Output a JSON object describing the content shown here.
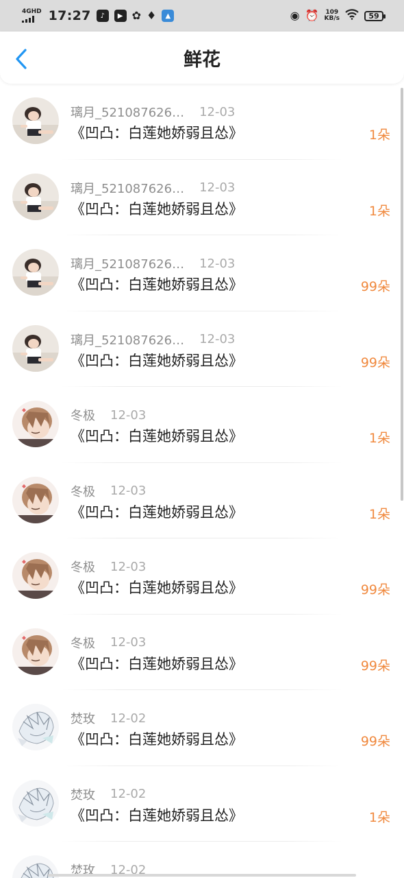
{
  "status_bar": {
    "network": "4GHD",
    "time": "17:27",
    "notification_icons": [
      "tiktok-icon",
      "video-icon",
      "wechat-icon",
      "pin-icon",
      "map-app-icon"
    ],
    "status_icons": [
      "location-icon",
      "alarm-icon"
    ],
    "speed_value": "109",
    "speed_unit": "KB/s",
    "battery": "59"
  },
  "header": {
    "title": "鲜花",
    "back_icon": "chevron-left-icon"
  },
  "colors": {
    "accent": "#2196f3",
    "amount": "#f0893e",
    "username": "#8e8e8e",
    "date": "#aaaaaa",
    "text": "#222222"
  },
  "rows": [
    {
      "avatar": "girl-photo-avatar",
      "user": "璃月_521087626…",
      "date": "12-03",
      "book": "《凹凸：白莲她娇弱且怂》",
      "amount": "1朵"
    },
    {
      "avatar": "girl-photo-avatar",
      "user": "璃月_521087626…",
      "date": "12-03",
      "book": "《凹凸：白莲她娇弱且怂》",
      "amount": "1朵"
    },
    {
      "avatar": "girl-photo-avatar",
      "user": "璃月_521087626…",
      "date": "12-03",
      "book": "《凹凸：白莲她娇弱且怂》",
      "amount": "99朵"
    },
    {
      "avatar": "girl-photo-avatar",
      "user": "璃月_521087626…",
      "date": "12-03",
      "book": "《凹凸：白莲她娇弱且怂》",
      "amount": "99朵"
    },
    {
      "avatar": "anime-boy-avatar",
      "user": "冬极",
      "date": "12-03",
      "book": "《凹凸：白莲她娇弱且怂》",
      "amount": "1朵"
    },
    {
      "avatar": "anime-boy-avatar",
      "user": "冬极",
      "date": "12-03",
      "book": "《凹凸：白莲她娇弱且怂》",
      "amount": "1朵"
    },
    {
      "avatar": "anime-boy-avatar",
      "user": "冬极",
      "date": "12-03",
      "book": "《凹凸：白莲她娇弱且怂》",
      "amount": "99朵"
    },
    {
      "avatar": "anime-boy-avatar",
      "user": "冬极",
      "date": "12-03",
      "book": "《凹凸：白莲她娇弱且怂》",
      "amount": "99朵"
    },
    {
      "avatar": "sketch-avatar",
      "user": "焚玫",
      "date": "12-02",
      "book": "《凹凸：白莲她娇弱且怂》",
      "amount": "99朵"
    },
    {
      "avatar": "sketch-avatar",
      "user": "焚玫",
      "date": "12-02",
      "book": "《凹凸：白莲她娇弱且怂》",
      "amount": "1朵"
    },
    {
      "avatar": "sketch-avatar",
      "user": "焚玫",
      "date": "12-02",
      "book": "",
      "amount": ""
    }
  ]
}
